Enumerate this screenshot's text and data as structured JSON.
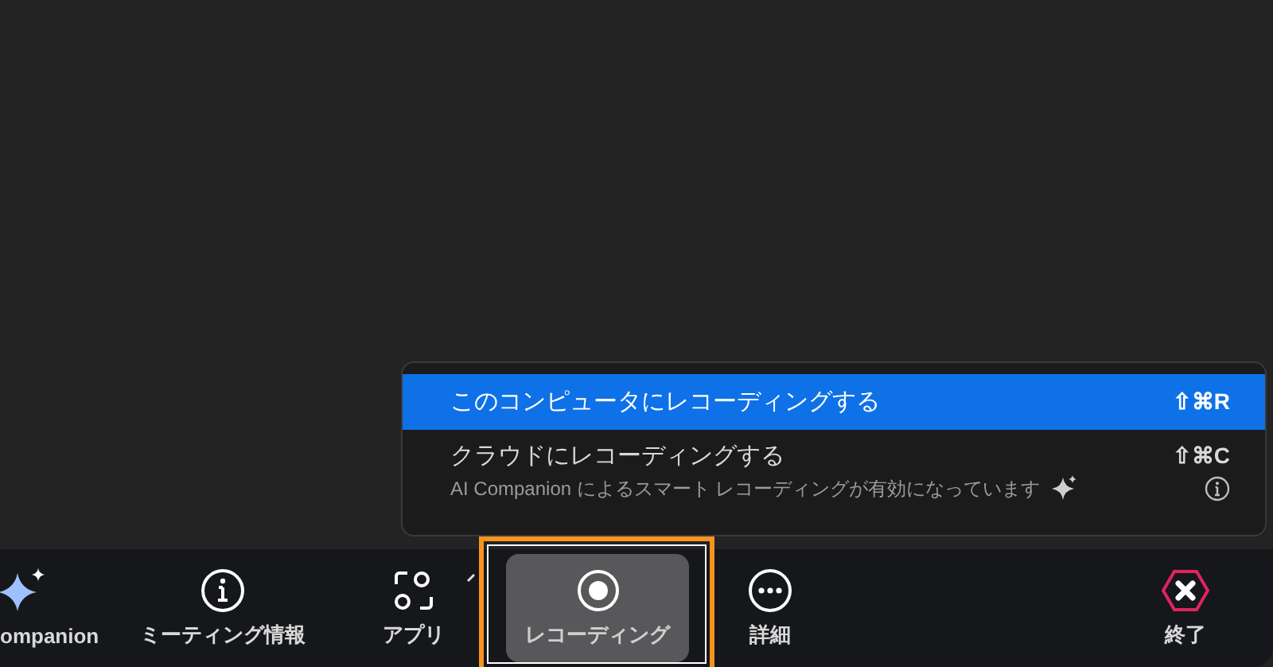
{
  "menu": {
    "items": [
      {
        "label": "このコンピュータにレコーディングする",
        "shortcut": "⇧⌘R",
        "selected": true
      },
      {
        "label": "クラウドにレコーディングする",
        "shortcut": "⇧⌘C",
        "selected": false,
        "note": "AI Companion によるスマート レコーディングが有効になっています"
      }
    ]
  },
  "toolbar": {
    "items": [
      {
        "label": "ompanion",
        "selected": false,
        "focused": false
      },
      {
        "label": "ミーティング情報",
        "selected": false,
        "focused": false
      },
      {
        "label": "アプリ",
        "selected": false,
        "focused": false
      },
      {
        "label": "レコーディング",
        "selected": true,
        "focused": true
      },
      {
        "label": "詳細",
        "selected": false,
        "focused": false
      },
      {
        "label": "終了",
        "selected": false,
        "focused": false
      }
    ]
  }
}
